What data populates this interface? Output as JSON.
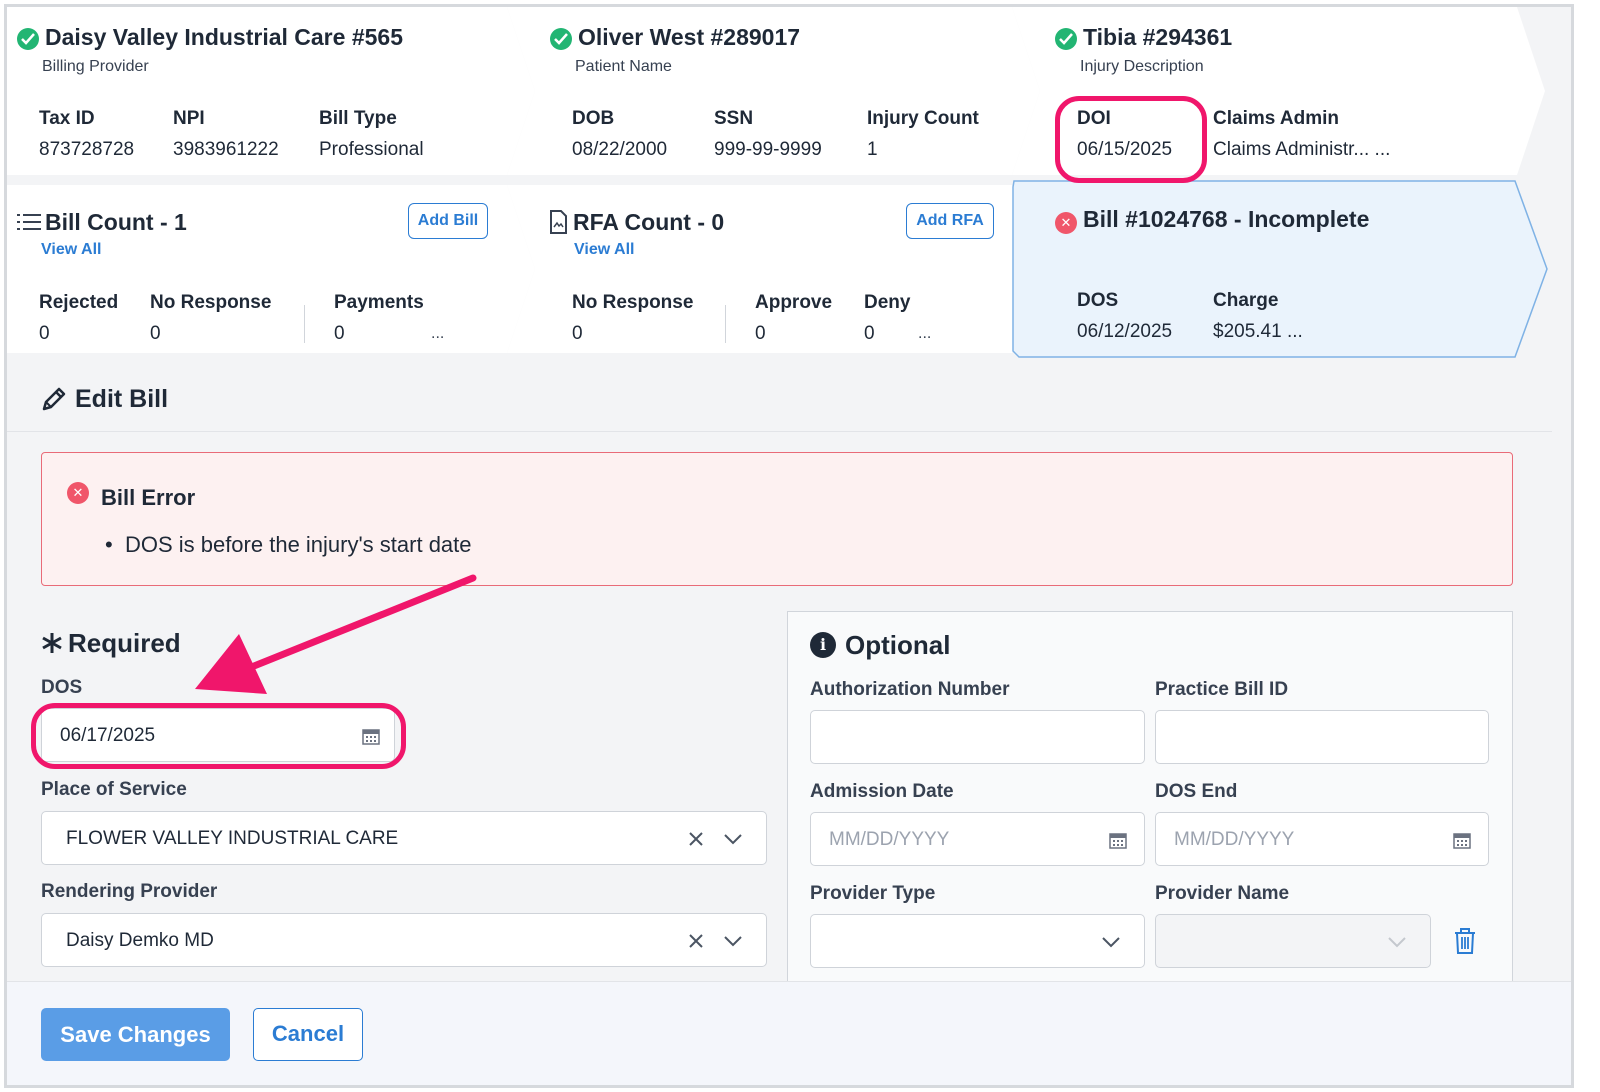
{
  "provider_card": {
    "title": "Daisy Valley Industrial Care #565",
    "subtitle": "Billing Provider",
    "fields": [
      {
        "label": "Tax ID",
        "value": "873728728"
      },
      {
        "label": "NPI",
        "value": "3983961222"
      },
      {
        "label": "Bill Type",
        "value": "Professional"
      }
    ]
  },
  "patient_card": {
    "title": "Oliver West #289017",
    "subtitle": "Patient Name",
    "fields": [
      {
        "label": "DOB",
        "value": "08/22/2000"
      },
      {
        "label": "SSN",
        "value": "999-99-9999"
      },
      {
        "label": "Injury Count",
        "value": "1"
      }
    ]
  },
  "injury_card": {
    "title": "Tibia #294361",
    "subtitle": "Injury Description",
    "fields": [
      {
        "label": "DOI",
        "value": "06/15/2025"
      },
      {
        "label": "Claims Admin",
        "value": "Claims Administr... ..."
      }
    ]
  },
  "bill_count_card": {
    "title": "Bill Count - 1",
    "link": "View All",
    "button": "Add Bill",
    "fields": [
      {
        "label": "Rejected",
        "value": "0"
      },
      {
        "label": "No Response",
        "value": "0"
      },
      {
        "label": "Payments",
        "value": "0"
      }
    ],
    "more": "..."
  },
  "rfa_count_card": {
    "title": "RFA Count - 0",
    "link": "View All",
    "button": "Add RFA",
    "fields": [
      {
        "label": "No Response",
        "value": "0"
      },
      {
        "label": "Approve",
        "value": "0"
      },
      {
        "label": "Deny",
        "value": "0"
      }
    ],
    "more": "..."
  },
  "bill_card": {
    "title": "Bill #1024768 - Incomplete",
    "fields": [
      {
        "label": "DOS",
        "value": "06/12/2025"
      },
      {
        "label": "Charge",
        "value": "$205.41 ..."
      }
    ]
  },
  "edit": {
    "title": "Edit Bill",
    "error_title": "Bill Error",
    "error_items": [
      "DOS is before the injury's start date"
    ]
  },
  "required": {
    "title": "Required",
    "dos_label": "DOS",
    "dos_value": "06/17/2025",
    "place_label": "Place of Service",
    "place_value": "FLOWER VALLEY INDUSTRIAL CARE",
    "rendering_label": "Rendering Provider",
    "rendering_value": "Daisy Demko MD"
  },
  "optional": {
    "title": "Optional",
    "auth_label": "Authorization Number",
    "practice_label": "Practice Bill ID",
    "admission_label": "Admission Date",
    "admission_placeholder": "MM/DD/YYYY",
    "dos_end_label": "DOS End",
    "dos_end_placeholder": "MM/DD/YYYY",
    "provider_type_label": "Provider Type",
    "provider_name_label": "Provider Name"
  },
  "footer": {
    "save_label": "Save Changes",
    "cancel_label": "Cancel"
  },
  "colors": {
    "accent": "#2b7cd3",
    "success": "#22b573",
    "error": "#f0566a",
    "highlight": "#f0166b",
    "primary_button": "#5a9de6"
  }
}
